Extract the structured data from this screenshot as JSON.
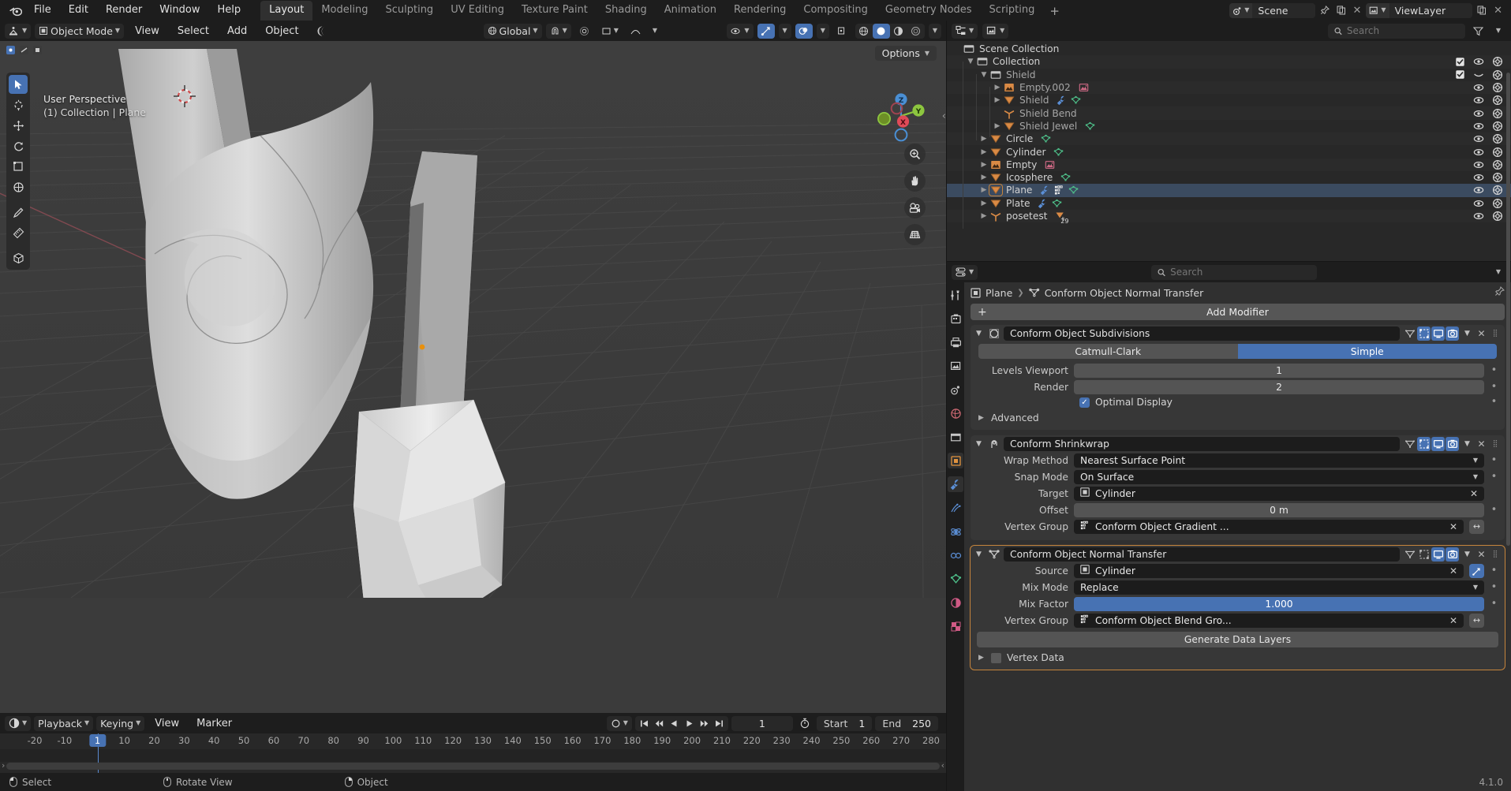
{
  "app": {
    "version": "4.1.0",
    "menus": [
      "File",
      "Edit",
      "Render",
      "Window",
      "Help"
    ],
    "workspaces": [
      "Layout",
      "Modeling",
      "Sculpting",
      "UV Editing",
      "Texture Paint",
      "Shading",
      "Animation",
      "Rendering",
      "Compositing",
      "Geometry Nodes",
      "Scripting"
    ],
    "active_workspace": "Layout",
    "add_workspace_label": "+",
    "scene_name": "Scene",
    "viewlayer_name": "ViewLayer"
  },
  "viewport_header": {
    "mode": "Object Mode",
    "menus": [
      "View",
      "Select",
      "Add",
      "Object"
    ],
    "transform_orientation": "Global",
    "options_label": "Options"
  },
  "viewport": {
    "perspective_label": "User Perspective",
    "context_label": "(1) Collection | Plane",
    "gizmo_axes": [
      "Z",
      "Y",
      "X"
    ],
    "axis_colors": {
      "x": "#e04a58",
      "y": "#8dc63f",
      "z": "#4a8fd4"
    }
  },
  "outliner": {
    "search_placeholder": "Search",
    "rows": [
      {
        "label": "Scene Collection",
        "icon": "collection-icon",
        "depth": 0,
        "disclosure": "none",
        "dim": false,
        "extras": [],
        "show_toggles": false,
        "checkbox": false,
        "selected": false
      },
      {
        "label": "Collection",
        "icon": "collection-icon",
        "depth": 1,
        "disclosure": "down",
        "dim": false,
        "extras": [],
        "show_toggles": true,
        "checkbox": true,
        "selected": false
      },
      {
        "label": "Shield",
        "icon": "collection-icon",
        "depth": 2,
        "disclosure": "down",
        "dim": true,
        "extras": [],
        "show_toggles": true,
        "checkbox": true,
        "selected": false
      },
      {
        "label": "Empty.002",
        "icon": "image-empty-icon",
        "depth": 3,
        "disclosure": "right",
        "dim": true,
        "extras": [
          "image-data-icon"
        ],
        "show_toggles": true,
        "checkbox": false,
        "selected": false
      },
      {
        "label": "Shield",
        "icon": "mesh-icon",
        "depth": 3,
        "disclosure": "right",
        "dim": true,
        "extras": [
          "wrench-icon",
          "mesh-data-icon"
        ],
        "show_toggles": true,
        "checkbox": false,
        "selected": false
      },
      {
        "label": "Shield Bend",
        "icon": "empty-axes-icon",
        "depth": 3,
        "disclosure": "none",
        "dim": true,
        "extras": [],
        "show_toggles": true,
        "checkbox": false,
        "selected": false
      },
      {
        "label": "Shield Jewel",
        "icon": "mesh-icon",
        "depth": 3,
        "disclosure": "right",
        "dim": true,
        "extras": [
          "mesh-data-icon"
        ],
        "show_toggles": true,
        "checkbox": false,
        "selected": false
      },
      {
        "label": "Circle",
        "icon": "mesh-icon",
        "depth": 2,
        "disclosure": "right",
        "dim": false,
        "extras": [
          "mesh-data-icon"
        ],
        "show_toggles": true,
        "checkbox": false,
        "selected": false
      },
      {
        "label": "Cylinder",
        "icon": "mesh-icon",
        "depth": 2,
        "disclosure": "right",
        "dim": false,
        "extras": [
          "mesh-data-icon"
        ],
        "show_toggles": true,
        "checkbox": false,
        "selected": false
      },
      {
        "label": "Empty",
        "icon": "image-empty-icon",
        "depth": 2,
        "disclosure": "right",
        "dim": false,
        "extras": [
          "image-data-icon"
        ],
        "show_toggles": true,
        "checkbox": false,
        "selected": false
      },
      {
        "label": "Icosphere",
        "icon": "mesh-icon",
        "depth": 2,
        "disclosure": "right",
        "dim": false,
        "extras": [
          "mesh-data-icon"
        ],
        "show_toggles": true,
        "checkbox": false,
        "selected": false
      },
      {
        "label": "Plane",
        "icon": "mesh-icon",
        "depth": 2,
        "disclosure": "right",
        "dim": false,
        "extras": [
          "wrench-icon",
          "vertexgroup-icon",
          "mesh-data-icon"
        ],
        "show_toggles": true,
        "checkbox": false,
        "selected": true
      },
      {
        "label": "Plate",
        "icon": "mesh-icon",
        "depth": 2,
        "disclosure": "right",
        "dim": false,
        "extras": [
          "wrench-icon",
          "mesh-data-icon"
        ],
        "show_toggles": true,
        "checkbox": false,
        "selected": false
      },
      {
        "label": "posetest",
        "icon": "armature-icon",
        "depth": 2,
        "disclosure": "right",
        "dim": false,
        "extras": [
          "mesh-count-icon"
        ],
        "badge": "29",
        "show_toggles": true,
        "checkbox": false,
        "selected": false
      }
    ]
  },
  "properties": {
    "search_placeholder": "Search",
    "breadcrumb": {
      "object": "Plane",
      "modifier": "Conform Object Normal Transfer"
    },
    "add_modifier_label": "Add Modifier",
    "modifiers": [
      {
        "name": "Conform Object Subdivisions",
        "type_icon": "subsurf-icon",
        "toggles": [
          {
            "name": "edit-mode-cage",
            "on": false
          },
          {
            "name": "edit-mode",
            "on": true
          },
          {
            "name": "realtime",
            "on": true
          },
          {
            "name": "render",
            "on": true
          }
        ],
        "segmented": {
          "options": [
            "Catmull-Clark",
            "Simple"
          ],
          "active": "Simple"
        },
        "rows": [
          {
            "label": "Levels Viewport",
            "value": "1",
            "kind": "number"
          },
          {
            "label": "Render",
            "value": "2",
            "kind": "number"
          }
        ],
        "checkbox": {
          "label": "Optimal Display",
          "checked": true
        },
        "subpanels": [
          "Advanced"
        ],
        "focused": false
      },
      {
        "name": "Conform Shrinkwrap",
        "type_icon": "shrinkwrap-icon",
        "toggles": [
          {
            "name": "edit-mode-cage",
            "on": false
          },
          {
            "name": "edit-mode",
            "on": true
          },
          {
            "name": "realtime",
            "on": true
          },
          {
            "name": "render",
            "on": true
          }
        ],
        "rows": [
          {
            "label": "Wrap Method",
            "value": "Nearest Surface Point",
            "kind": "dropdown"
          },
          {
            "label": "Snap Mode",
            "value": "On Surface",
            "kind": "dropdown"
          },
          {
            "label": "Target",
            "value": "Cylinder",
            "kind": "object"
          },
          {
            "label": "Offset",
            "value": "0 m",
            "kind": "number"
          },
          {
            "label": "Vertex Group",
            "value": "Conform Object Gradient ...",
            "kind": "vgroup"
          }
        ],
        "focused": false
      },
      {
        "name": "Conform Object Normal Transfer",
        "type_icon": "datatransfer-icon",
        "toggles": [
          {
            "name": "edit-mode-cage",
            "on": false
          },
          {
            "name": "edit-mode",
            "on": false
          },
          {
            "name": "realtime",
            "on": true
          },
          {
            "name": "render",
            "on": true
          }
        ],
        "rows": [
          {
            "label": "Source",
            "value": "Cylinder",
            "kind": "object-source"
          },
          {
            "label": "Mix Mode",
            "value": "Replace",
            "kind": "dropdown"
          },
          {
            "label": "Mix Factor",
            "value": "1.000",
            "kind": "slider"
          },
          {
            "label": "Vertex Group",
            "value": "Conform Object Blend Gro...",
            "kind": "vgroup"
          }
        ],
        "generate_label": "Generate Data Layers",
        "subpanels": [
          "Vertex Data"
        ],
        "focused": true
      }
    ]
  },
  "timeline": {
    "menus": [
      "Playback",
      "Keying",
      "View",
      "Marker"
    ],
    "current_frame": "1",
    "start_label": "Start",
    "start_value": "1",
    "end_label": "End",
    "end_value": "250",
    "ticks": [
      "-20",
      "-10",
      "1",
      "10",
      "20",
      "30",
      "40",
      "50",
      "60",
      "70",
      "80",
      "90",
      "100",
      "110",
      "120",
      "130",
      "140",
      "150",
      "160",
      "170",
      "180",
      "190",
      "200",
      "210",
      "220",
      "230",
      "240",
      "250",
      "260",
      "270",
      "280"
    ],
    "playhead_frame": "1"
  },
  "statusbar": {
    "items": [
      {
        "icon": "mouse-left-icon",
        "label": "Select"
      },
      {
        "icon": "mouse-middle-icon",
        "label": "Rotate View"
      },
      {
        "icon": "mouse-right-icon",
        "label": "Object"
      }
    ],
    "version": "4.1.0"
  },
  "colors": {
    "accent_blue": "#4772b3",
    "panel_bg": "#303030",
    "editor_bg": "#282828",
    "window_bg": "#1d1d1d",
    "outliner_mesh": "#d98a45",
    "mesh_data": "#4ec08a",
    "select_outline": "#c5843c"
  }
}
